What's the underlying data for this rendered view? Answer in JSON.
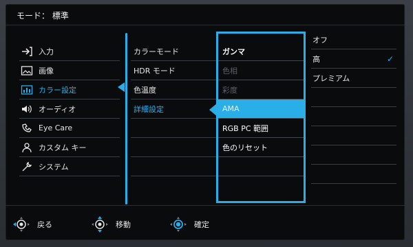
{
  "header": {
    "title": "モード： 標準"
  },
  "nav": {
    "items": [
      {
        "label": "入力",
        "icon": "input-icon"
      },
      {
        "label": "画像",
        "icon": "picture-icon"
      },
      {
        "label": "カラー設定",
        "icon": "color-settings-icon",
        "active": true
      },
      {
        "label": "オーディオ",
        "icon": "speaker-icon"
      },
      {
        "label": "Eye Care",
        "icon": "eye-care-icon"
      },
      {
        "label": "カスタム キー",
        "icon": "person-icon"
      },
      {
        "label": "システム",
        "icon": "wrench-icon"
      }
    ]
  },
  "submenu": {
    "items": [
      {
        "label": "カラーモード"
      },
      {
        "label": "HDR モード"
      },
      {
        "label": "色温度"
      },
      {
        "label": "詳細設定",
        "active": true
      }
    ]
  },
  "detail": {
    "items": [
      {
        "label": "ガンマ",
        "state": "bold"
      },
      {
        "label": "色相",
        "state": "disabled"
      },
      {
        "label": "彩度",
        "state": "disabled"
      },
      {
        "label": "AMA",
        "state": "selected"
      },
      {
        "label": "RGB PC 範囲",
        "state": "normal"
      },
      {
        "label": "色のリセット",
        "state": "normal"
      }
    ]
  },
  "options": {
    "items": [
      {
        "label": "オフ",
        "checked": false
      },
      {
        "label": "高",
        "checked": true
      },
      {
        "label": "プレミアム",
        "checked": false
      }
    ],
    "check_mark": "✓"
  },
  "bottom": {
    "back_label": "戻る",
    "move_label": "移動",
    "confirm_label": "確定"
  },
  "colors": {
    "accent": "#2aaee8",
    "background": "#0a0b0d"
  }
}
